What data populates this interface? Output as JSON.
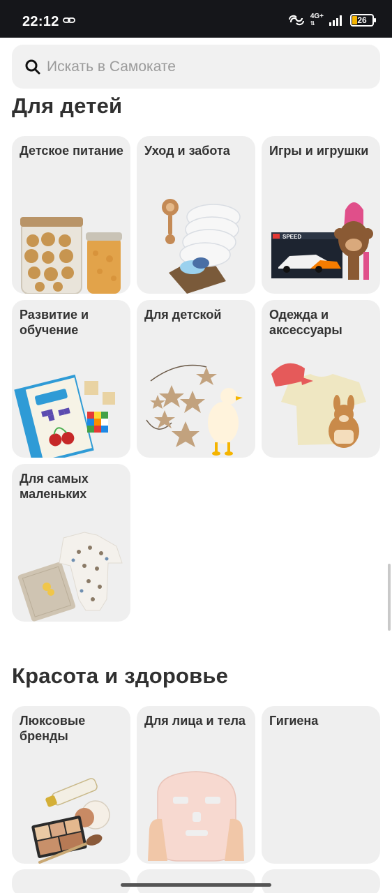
{
  "status_bar": {
    "time": "22:12",
    "network": "4G+",
    "battery": "26"
  },
  "search": {
    "placeholder": "Искать в Самокате"
  },
  "sections": [
    {
      "title": "Для детей",
      "categories": [
        {
          "label": "Детское питание",
          "image": "jars-of-baby-food"
        },
        {
          "label": "Уход и забота",
          "image": "diapers-basket-rattle"
        },
        {
          "label": "Игры и игрушки",
          "image": "lego-speed-box-and-doll"
        },
        {
          "label": "Развитие и обучение",
          "image": "workbook-and-cubes"
        },
        {
          "label": "Для детской",
          "image": "star-garland-and-night-lamp"
        },
        {
          "label": "Одежда и аксессуары",
          "image": "tshirt-cap-backpack"
        },
        {
          "label": "Для самых маленьких",
          "image": "bodysuit-and-blanket"
        }
      ]
    },
    {
      "title": "Красота и здоровье",
      "categories": [
        {
          "label": "Люксовые бренды",
          "image": "makeup-palette-brush"
        },
        {
          "label": "Для лица и тела",
          "image": "sheet-face-mask"
        },
        {
          "label": "Гигиена",
          "image": ""
        }
      ]
    }
  ],
  "colors": {
    "statusbar": "#15161a",
    "card_bg": "#efefef",
    "search_bg": "#f1f1f1",
    "battery_accent": "#f5b400"
  }
}
